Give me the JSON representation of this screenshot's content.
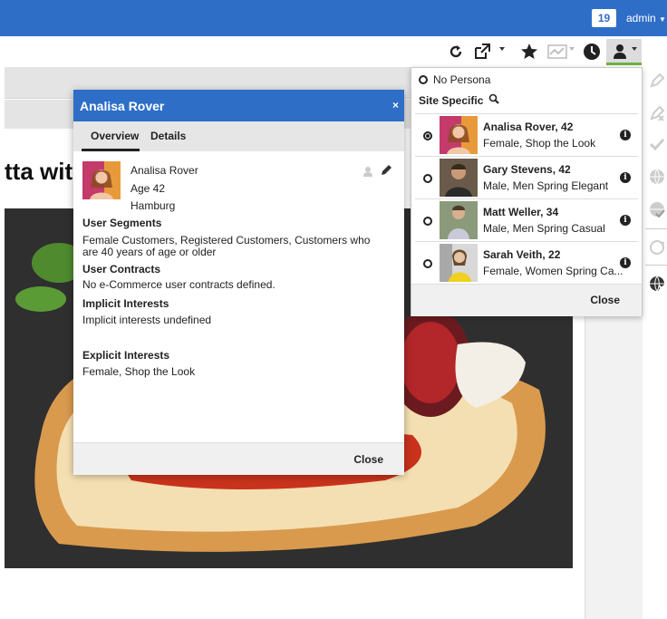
{
  "topbar": {
    "notification_count": "19",
    "user_label": "admin"
  },
  "toolbar": {
    "icons": [
      "refresh-icon",
      "open-external-icon",
      "star-icon",
      "preview-chart-icon",
      "clock-icon",
      "persona-icon"
    ],
    "active_color": "#6cb33f"
  },
  "page": {
    "headline": "tta wit"
  },
  "persona_menu": {
    "no_persona_label": "No Persona",
    "site_specific_label": "Site Specific",
    "personas": [
      {
        "name": "Analisa Rover, 42",
        "description": "Female, Shop the Look",
        "selected": true
      },
      {
        "name": "Gary Stevens, 42",
        "description": "Male, Men Spring Elegant",
        "selected": false
      },
      {
        "name": "Matt Weller, 34",
        "description": "Male, Men Spring Casual",
        "selected": false
      },
      {
        "name": "Sarah Veith, 22",
        "description": "Female, Women Spring Ca...",
        "selected": false
      }
    ],
    "close_label": "Close"
  },
  "dialog": {
    "title": "Analisa Rover",
    "close_x": "×",
    "tabs": [
      "Overview",
      "Details"
    ],
    "name": "Analisa Rover",
    "age": "Age 42",
    "city": "Hamburg",
    "segments_heading": "User Segments",
    "segments_text": "Female Customers, Registered Customers, Customers who are 40 years of age or older",
    "contracts_heading": "User Contracts",
    "contracts_text": "No e-Commerce user contracts defined.",
    "implicit_heading": "Implicit Interests",
    "implicit_text": "Implicit interests undefined",
    "explicit_heading": "Explicit Interests",
    "explicit_text": "Female, Shop the Look",
    "close_label": "Close"
  },
  "colors": {
    "brand_blue": "#2e6ec7",
    "accent_green": "#6cb33f"
  }
}
